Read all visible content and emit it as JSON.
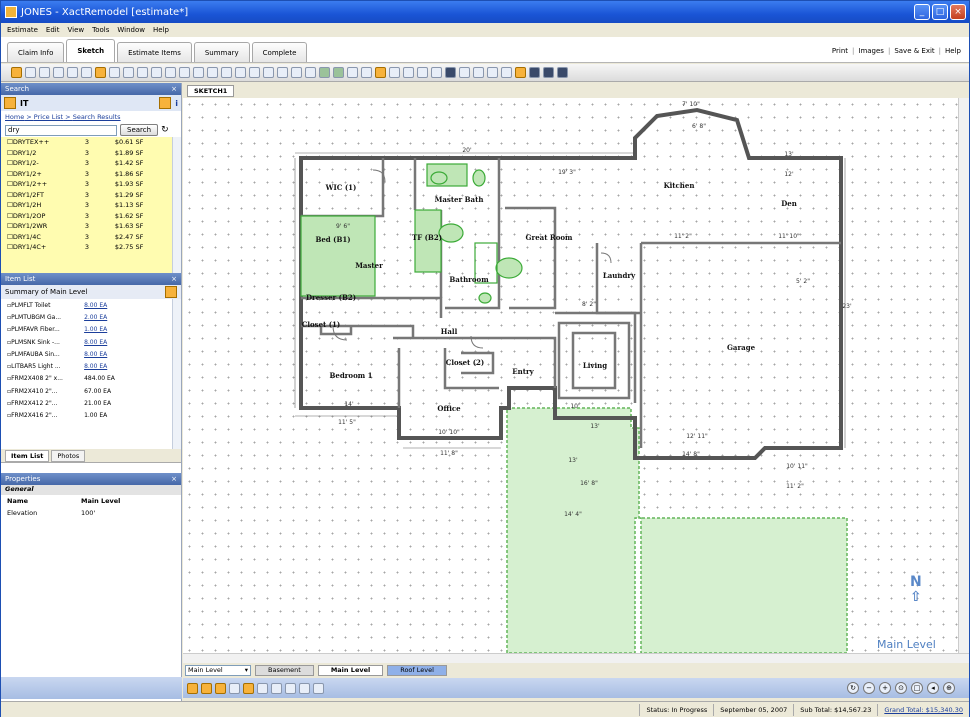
{
  "window": {
    "title": "JONES - XactRemodel [estimate*]"
  },
  "menu": [
    "Estimate",
    "Edit",
    "View",
    "Tools",
    "Window",
    "Help"
  ],
  "tabs": [
    "Claim Info",
    "Sketch",
    "Estimate Items",
    "Summary",
    "Complete"
  ],
  "top_links": [
    "Print",
    "Images",
    "Save & Exit",
    "Help"
  ],
  "search": {
    "panel_title": "Search",
    "header_value": "IT",
    "crumbs": [
      "Home",
      "Price List",
      "Search Results"
    ],
    "query": "dry",
    "button": "Search",
    "results": [
      {
        "code": "DRYTEX++",
        "qty": "3",
        "price": "$0.61 SF"
      },
      {
        "code": "DRY1/2",
        "qty": "3",
        "price": "$1.89 SF"
      },
      {
        "code": "DRY1/2-",
        "qty": "3",
        "price": "$1.42 SF"
      },
      {
        "code": "DRY1/2+",
        "qty": "3",
        "price": "$1.86 SF"
      },
      {
        "code": "DRY1/2++",
        "qty": "3",
        "price": "$1.93 SF"
      },
      {
        "code": "DRY1/2FT",
        "qty": "3",
        "price": "$1.29 SF"
      },
      {
        "code": "DRY1/2H",
        "qty": "3",
        "price": "$1.13 SF"
      },
      {
        "code": "DRY1/2OP",
        "qty": "3",
        "price": "$1.62 SF"
      },
      {
        "code": "DRY1/2WR",
        "qty": "3",
        "price": "$1.63 SF"
      },
      {
        "code": "DRY1/4C",
        "qty": "3",
        "price": "$2.47 SF"
      },
      {
        "code": "DRY1/4C+",
        "qty": "3",
        "price": "$2.75 SF"
      }
    ]
  },
  "itemlist": {
    "panel_title": "Item List",
    "header": "Summary of Main Level",
    "items": [
      {
        "name": "PLMFLT  Toilet",
        "qty": "8.00 EA",
        "link": true
      },
      {
        "name": "PLMTUBGM  Ga...",
        "qty": "2.00 EA",
        "link": true
      },
      {
        "name": "PLMFAVR  Fiber...",
        "qty": "1.00 EA",
        "link": true
      },
      {
        "name": "PLMSNK  Sink -...",
        "qty": "8.00 EA",
        "link": true
      },
      {
        "name": "PLMFAUBA  Sin...",
        "qty": "8.00 EA",
        "link": true
      },
      {
        "name": "LITBAR5  Light ...",
        "qty": "8.00 EA",
        "link": true
      },
      {
        "name": "FRM2X408  2\" x...",
        "qty": "484.00 EA",
        "link": false
      },
      {
        "name": "FRM2X410  2\"...",
        "qty": "67.00 EA",
        "link": false
      },
      {
        "name": "FRM2X412  2\"...",
        "qty": "21.00 EA",
        "link": false
      },
      {
        "name": "FRM2X416  2\"...",
        "qty": "1.00 EA",
        "link": false
      }
    ],
    "bottom_tabs": [
      "Item List",
      "Photos"
    ]
  },
  "properties": {
    "panel_title": "Properties",
    "section": "General",
    "col_name": "Name",
    "col_value": "Main Level",
    "rows": [
      {
        "k": "Elevation",
        "v": "100'"
      }
    ]
  },
  "sketch": {
    "tab": "SKETCH1",
    "rooms": [
      "WIC (1)",
      "Master Bath",
      "Bed (B1)",
      "TF (B2)",
      "Master",
      "Great Room",
      "Kitchen",
      "Den",
      "Bathroom",
      "Dresser (B2)",
      "Closet (1)",
      "Hall",
      "Bedroom 1",
      "Closet (2)",
      "Office",
      "Entry",
      "Living",
      "Laundry",
      "Garage"
    ],
    "dims": [
      "20'",
      "19' 3\"",
      "7' 10\"",
      "6' 8\"",
      "13'",
      "12'",
      "11' 2\"",
      "11' 10\"",
      "5' 2\"",
      "9' 6\"",
      "8' 2\"",
      "14'",
      "11' 5\"",
      "10' 10\"",
      "11' 8\"",
      "13'",
      "10'",
      "12' 11\"",
      "10' 11\"",
      "14' 4\"",
      "16' 8\"",
      "23'",
      "14' 8\"",
      "11' 2\"",
      "13'"
    ],
    "level_label": "Main Level",
    "north": "N"
  },
  "levels": {
    "selected": "Main Level",
    "tabs": [
      "Basement",
      "Main Level",
      "Roof Level"
    ]
  },
  "status": {
    "status_label": "Status:",
    "status_value": "In Progress",
    "date": "September 05, 2007",
    "subtotal": "Sub Total: $14,567.23",
    "grand": "Grand Total: $15,340.30"
  }
}
